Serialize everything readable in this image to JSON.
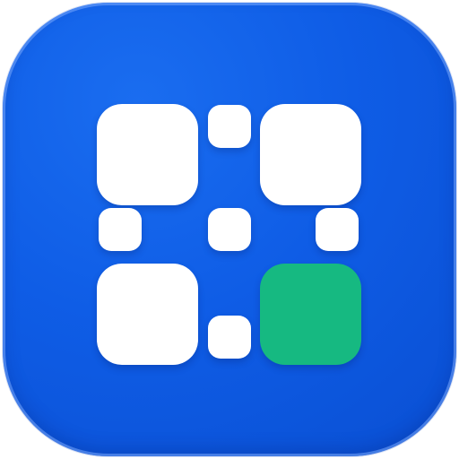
{
  "icon": {
    "name": "grid-dots-app-icon",
    "background_color": "#0f5de6",
    "tile_color": "#ffffff",
    "accent_tile_color": "#16b981"
  }
}
